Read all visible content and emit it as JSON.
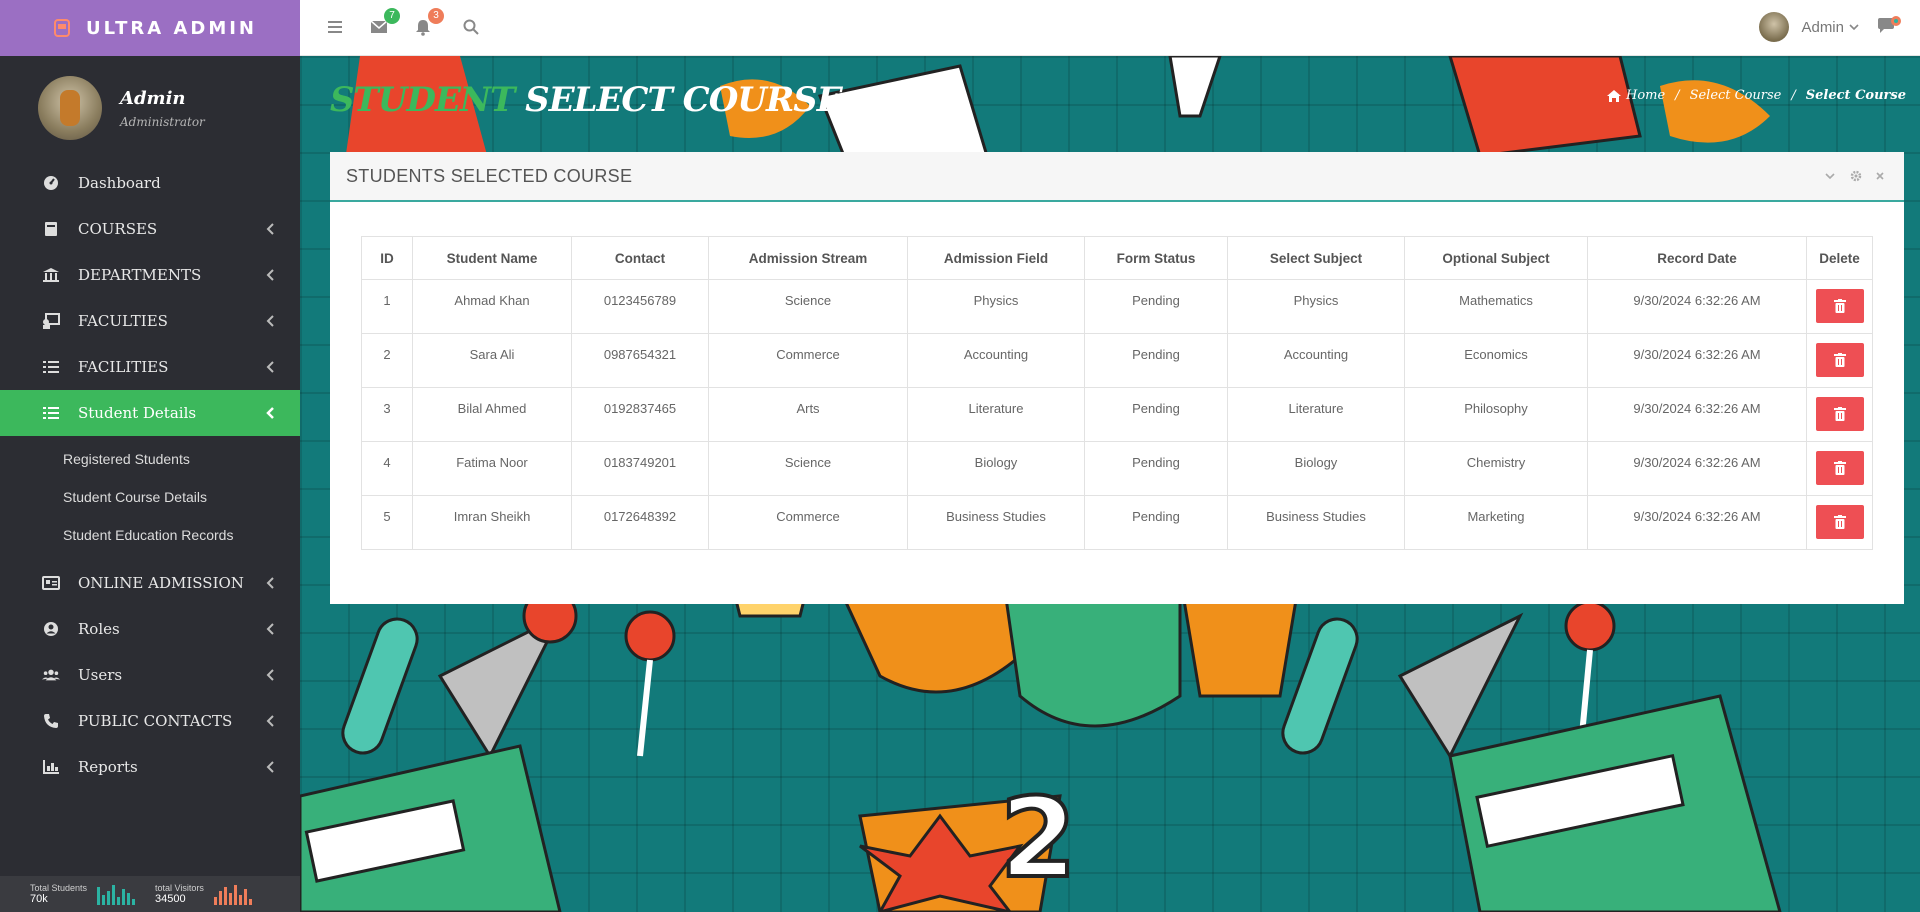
{
  "brand": {
    "name": "ULTRA ADMIN"
  },
  "profile": {
    "name": "Admin",
    "role": "Administrator"
  },
  "menu": [
    {
      "label": "Dashboard",
      "icon": "dashboard-icon",
      "chevron": false
    },
    {
      "label": "COURSES",
      "icon": "book-icon",
      "chevron": true
    },
    {
      "label": "DEPARTMENTS",
      "icon": "bank-icon",
      "chevron": true
    },
    {
      "label": "FACULTIES",
      "icon": "teacher-icon",
      "chevron": true
    },
    {
      "label": "FACILITIES",
      "icon": "list-icon",
      "chevron": true
    },
    {
      "label": "Student Details",
      "icon": "list-icon",
      "chevron": true,
      "active": true
    },
    {
      "label": "ONLINE ADMISSION",
      "icon": "id-card-icon",
      "chevron": true
    },
    {
      "label": "Roles",
      "icon": "user-circle-icon",
      "chevron": true
    },
    {
      "label": "Users",
      "icon": "users-icon",
      "chevron": true
    },
    {
      "label": "PUBLIC CONTACTS",
      "icon": "phone-icon",
      "chevron": true
    },
    {
      "label": "Reports",
      "icon": "bar-chart-icon",
      "chevron": true
    }
  ],
  "submenu": [
    "Registered Students",
    "Student Course Details",
    "Student Education Records"
  ],
  "stats": [
    {
      "label": "Total Students",
      "value": "70k",
      "color": "#2bb3a3"
    },
    {
      "label": "total Visitors",
      "value": "34500",
      "color": "#ef7d5a"
    }
  ],
  "topbar": {
    "mail_badge": "7",
    "notif_badge": "3",
    "user": "Admin"
  },
  "page": {
    "title_part1": "STUDENT",
    "title_part2": "SELECT COURSE",
    "breadcrumb": [
      "Home",
      "Select Course",
      "Select Course"
    ]
  },
  "panel": {
    "title": "STUDENTS SELECTED COURSE"
  },
  "table": {
    "headers": [
      "ID",
      "Student Name",
      "Contact",
      "Admission Stream",
      "Admission Field",
      "Form Status",
      "Select Subject",
      "Optional Subject",
      "Record Date",
      "Delete"
    ],
    "rows": [
      [
        "1",
        "Ahmad Khan",
        "0123456789",
        "Science",
        "Physics",
        "Pending",
        "Physics",
        "Mathematics",
        "9/30/2024 6:32:26 AM"
      ],
      [
        "2",
        "Sara Ali",
        "0987654321",
        "Commerce",
        "Accounting",
        "Pending",
        "Accounting",
        "Economics",
        "9/30/2024 6:32:26 AM"
      ],
      [
        "3",
        "Bilal Ahmed",
        "0192837465",
        "Arts",
        "Literature",
        "Pending",
        "Literature",
        "Philosophy",
        "9/30/2024 6:32:26 AM"
      ],
      [
        "4",
        "Fatima Noor",
        "0183749201",
        "Science",
        "Biology",
        "Pending",
        "Biology",
        "Chemistry",
        "9/30/2024 6:32:26 AM"
      ],
      [
        "5",
        "Imran Sheikh",
        "0172648392",
        "Commerce",
        "Business Studies",
        "Pending",
        "Business Studies",
        "Marketing",
        "9/30/2024 6:32:26 AM"
      ]
    ]
  },
  "colors": {
    "accent_green": "#3cb85c",
    "brand_purple": "#9b6fc3",
    "delete_red": "#ee4f54",
    "teal_bg": "#127a7a"
  }
}
